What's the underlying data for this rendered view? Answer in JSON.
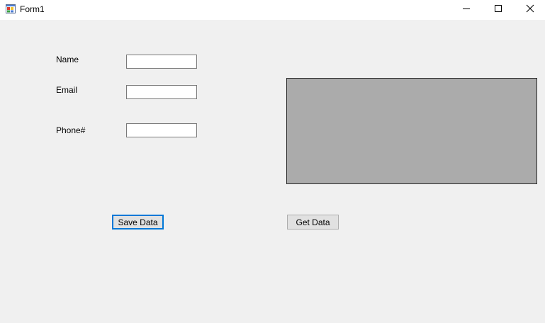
{
  "window": {
    "title": "Form1"
  },
  "form": {
    "name_label": "Name",
    "name_value": "",
    "email_label": "Email",
    "email_value": "",
    "phone_label": "Phone#",
    "phone_value": ""
  },
  "buttons": {
    "save_label": "Save Data",
    "get_label": "Get Data"
  },
  "icons": {
    "app": "form-app-icon",
    "minimize": "minimize-icon",
    "maximize": "maximize-icon",
    "close": "close-icon"
  },
  "colors": {
    "background": "#f0f0f0",
    "titlebar": "#ffffff",
    "grid_background": "#ababab",
    "focus_border": "#0078d7",
    "button_face": "#e1e1e1"
  }
}
